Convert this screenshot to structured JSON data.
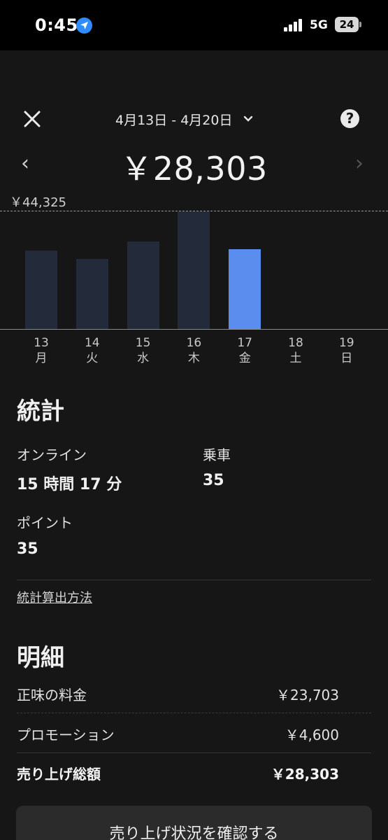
{
  "status_bar": {
    "time": "0:45",
    "network": "5G",
    "battery": "24"
  },
  "header": {
    "date_range": "4月13日 - 4月20日"
  },
  "summary": {
    "total": "￥28,303"
  },
  "chart_data": {
    "type": "bar",
    "categories": [
      "13",
      "14",
      "15",
      "16",
      "17",
      "18",
      "19"
    ],
    "weekdays": [
      "月",
      "火",
      "水",
      "木",
      "金",
      "土",
      "日"
    ],
    "values": [
      29500,
      26300,
      33100,
      44325,
      30200,
      0,
      0
    ],
    "selected_index": 4,
    "max_label": "￥44,325",
    "ylim": [
      0,
      44325
    ],
    "colors": {
      "bar": "#232b3a",
      "selected": "#5b8def"
    }
  },
  "stats": {
    "title": "統計",
    "online_label": "オンライン",
    "online_value": "15 時間 17 分",
    "rides_label": "乗車",
    "rides_value": "35",
    "points_label": "ポイント",
    "points_value": "35",
    "method_link": "統計算出方法"
  },
  "details": {
    "title": "明細",
    "rows": [
      {
        "label": "正味の料金",
        "value": "￥23,703"
      },
      {
        "label": "プロモーション",
        "value": "￥4,600"
      },
      {
        "label": "売り上げ総額",
        "value": "￥28,303"
      }
    ]
  },
  "footer": {
    "button_label": "売り上げ状況を確認する"
  }
}
